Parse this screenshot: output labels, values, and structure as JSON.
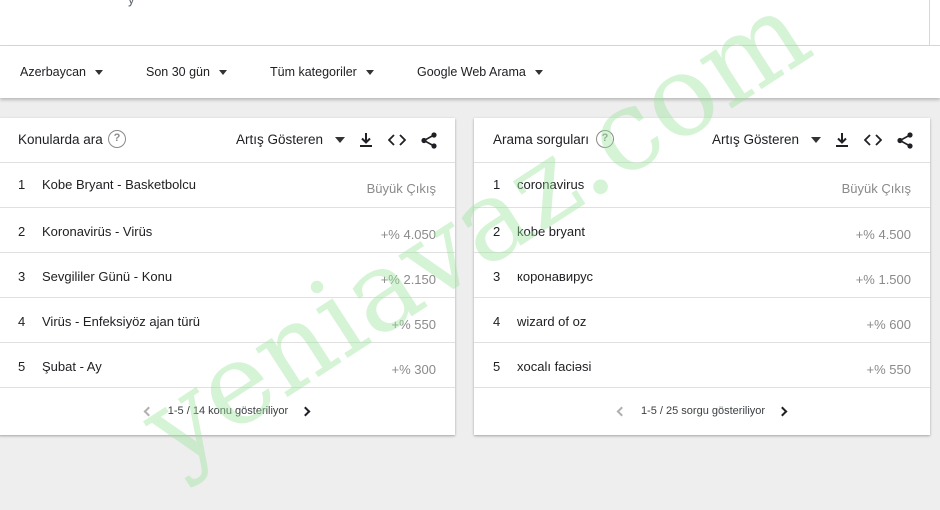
{
  "top": {
    "cut_text": "y"
  },
  "filters": [
    {
      "label": "Azerbaycan"
    },
    {
      "label": "Son 30 gün"
    },
    {
      "label": "Tüm kategoriler"
    },
    {
      "label": "Google Web Arama"
    }
  ],
  "cards": [
    {
      "title": "Konularda ara",
      "help_icon": "help-circle-icon",
      "sort_label": "Artış Gösteren",
      "rows": [
        {
          "rank": "1",
          "term": "Kobe Bryant - Basketbolcu",
          "value": "Büyük Çıkış"
        },
        {
          "rank": "2",
          "term": "Koronavirüs - Virüs",
          "value": "+% 4.050"
        },
        {
          "rank": "3",
          "term": "Sevgililer Günü - Konu",
          "value": "+% 2.150"
        },
        {
          "rank": "4",
          "term": "Virüs - Enfeksiyöz ajan türü",
          "value": "+% 550"
        },
        {
          "rank": "5",
          "term": "Şubat - Ay",
          "value": "+% 300"
        }
      ],
      "pager": "1-5 / 14 konu gösteriliyor"
    },
    {
      "title": "Arama sorguları",
      "help_icon": "help-circle-icon",
      "sort_label": "Artış Gösteren",
      "rows": [
        {
          "rank": "1",
          "term": "coronavirus",
          "value": "Büyük Çıkış"
        },
        {
          "rank": "2",
          "term": "kobe bryant",
          "value": "+% 4.500"
        },
        {
          "rank": "3",
          "term": "коронавирус",
          "value": "+% 1.500"
        },
        {
          "rank": "4",
          "term": "wizard of oz",
          "value": "+% 600"
        },
        {
          "rank": "5",
          "term": "xocalı faciəsi",
          "value": "+% 550"
        }
      ],
      "pager": "1-5 / 25 sorgu gösteriliyor"
    }
  ],
  "watermark": {
    "text": "yeniavaz.com",
    "color": "#9be39b"
  },
  "colors": {
    "background": "#eeeeee",
    "card": "#ffffff",
    "muted": "#8a8a8a"
  }
}
